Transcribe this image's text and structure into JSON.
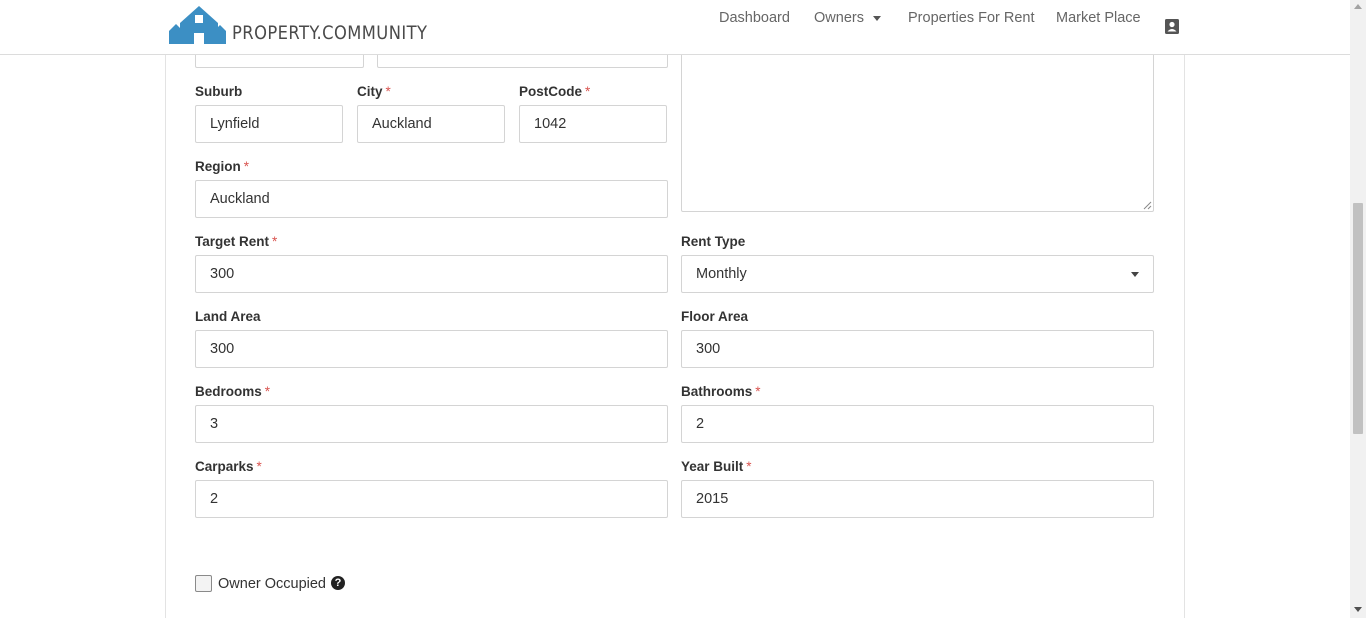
{
  "nav": {
    "brand": "PROPERTY.COMMUNITY",
    "dashboard": "Dashboard",
    "owners": "Owners",
    "properties_for_rent": "Properties For Rent",
    "market_place": "Market Place",
    "profile_icon": "contact-card-icon"
  },
  "colors": {
    "required": "#d9534f",
    "brand_blue": "#3c8fc4"
  },
  "form": {
    "suburb": {
      "label": "Suburb",
      "value": "Lynfield"
    },
    "city": {
      "label": "City",
      "value": "Auckland",
      "required": "*"
    },
    "postcode": {
      "label": "PostCode",
      "value": "1042",
      "required": "*"
    },
    "region": {
      "label": "Region",
      "value": "Auckland",
      "required": "*"
    },
    "target_rent": {
      "label": "Target Rent",
      "value": "300",
      "required": "*"
    },
    "rent_type": {
      "label": "Rent Type",
      "value": "Monthly"
    },
    "land_area": {
      "label": "Land Area",
      "value": "300"
    },
    "floor_area": {
      "label": "Floor Area",
      "value": "300"
    },
    "bedrooms": {
      "label": "Bedrooms",
      "value": "3",
      "required": "*"
    },
    "bathrooms": {
      "label": "Bathrooms",
      "value": "2",
      "required": "*"
    },
    "carparks": {
      "label": "Carparks",
      "value": "2",
      "required": "*"
    },
    "year_built": {
      "label": "Year Built",
      "value": "2015",
      "required": "*"
    },
    "owner_occupied": {
      "label": "Owner Occupied",
      "checked": false,
      "help": "?"
    }
  }
}
